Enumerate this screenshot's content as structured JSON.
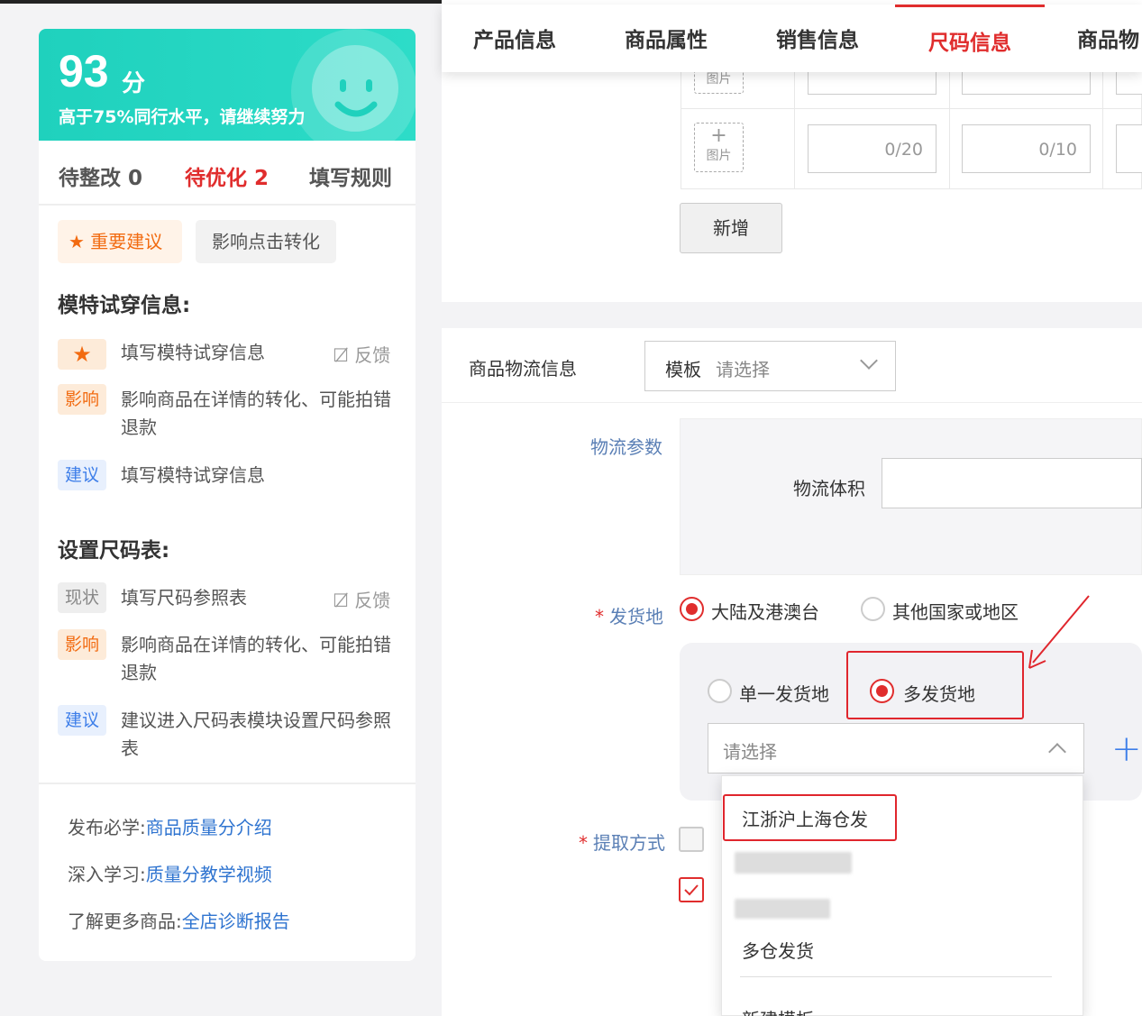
{
  "score": {
    "value": "93",
    "unit": "分",
    "description": "高于75%同行水平，请继续努力"
  },
  "status_tabs": [
    {
      "label": "待整改 0"
    },
    {
      "label": "待优化 2"
    },
    {
      "label": "填写规则"
    }
  ],
  "filter_tags": {
    "important": "重要建议",
    "impact": "影响点击转化"
  },
  "sections": [
    {
      "title": "模特试穿信息:",
      "items": [
        {
          "badge": "★",
          "text": "填写模特试穿信息",
          "feedback": "反馈"
        },
        {
          "badge": "影响",
          "text": "影响商品在详情的转化、可能拍错退款"
        },
        {
          "badge": "建议",
          "text": "填写模特试穿信息"
        }
      ]
    },
    {
      "title": "设置尺码表:",
      "items": [
        {
          "badge": "现状",
          "text": "填写尺码参照表",
          "feedback": "反馈"
        },
        {
          "badge": "影响",
          "text": "影响商品在详情的转化、可能拍错退款"
        },
        {
          "badge": "建议",
          "text": "建议进入尺码表模块设置尺码参照表"
        }
      ]
    }
  ],
  "learning": [
    {
      "prefix": "发布必学:",
      "link": "商品质量分介绍"
    },
    {
      "prefix": "深入学习:",
      "link": "质量分教学视频"
    },
    {
      "prefix": "了解更多商品:",
      "link": "全店诊断报告"
    }
  ],
  "nav_tabs": [
    {
      "label": "产品信息"
    },
    {
      "label": "商品属性"
    },
    {
      "label": "销售信息"
    },
    {
      "label": "尺码信息"
    },
    {
      "label": "商品物"
    }
  ],
  "size_table": {
    "image_label": "图片",
    "plus": "+",
    "counter_a": "0/20",
    "counter_b": "0/10",
    "add_button": "新增"
  },
  "logistics": {
    "label": "商品物流信息",
    "template_prefix": "模板",
    "template_placeholder": "请选择",
    "params_label": "物流参数",
    "volume_label": "物流体积",
    "ship_from_label": "发货地",
    "required_mark": "*",
    "ship_options": [
      {
        "label": "大陆及港澳台",
        "checked": true
      },
      {
        "label": "其他国家或地区",
        "checked": false
      }
    ],
    "warehouse_options": [
      {
        "label": "单一发货地",
        "checked": false
      },
      {
        "label": "多发货地",
        "checked": true
      }
    ],
    "warehouse_placeholder": "请选择",
    "add_icon": "+",
    "pickup_label": "提取方式",
    "dropdown_items": [
      {
        "label": "江浙沪上海仓发"
      },
      {
        "label": "多仓发货"
      },
      {
        "label": "新建模板"
      }
    ]
  },
  "colors": {
    "accent_red": "#e02d2d",
    "score_teal": "#1fd1bd",
    "link_blue": "#2f74d0",
    "annotation_red": "#e0262d"
  }
}
